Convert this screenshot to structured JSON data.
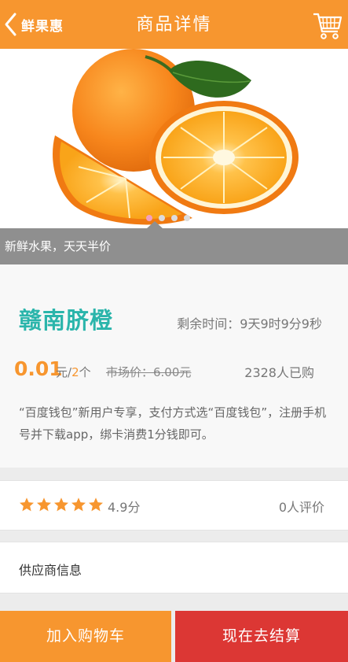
{
  "header": {
    "back_label": "鲜果惠",
    "title": "商品详情"
  },
  "banner": {
    "caption": "新鲜水果，天天半价",
    "dot_count": 4,
    "active_dot": 0
  },
  "product": {
    "name": "赣南脐橙",
    "remaining_time": "剩余时间：9天9时9分9秒",
    "price": "0.01",
    "unit_prefix": "元/",
    "unit_number": "2",
    "unit_suffix": "个",
    "market_price": "市场价：6.00元",
    "sold_count": "2328人已购",
    "description": "“百度钱包”新用户专享，支付方式选“百度钱包”，注册手机号并下载app，绑卡消费1分钱即可。"
  },
  "rating": {
    "stars": 5,
    "score_text": "4.9分",
    "reviews_text": "0人评价"
  },
  "supplier": {
    "label": "供应商信息"
  },
  "actions": {
    "add_to_cart": "加入购物车",
    "checkout": "现在去结算"
  },
  "colors": {
    "brand_orange": "#f7962f",
    "teal": "#2bb5ab",
    "checkout_red": "#dc3734"
  }
}
